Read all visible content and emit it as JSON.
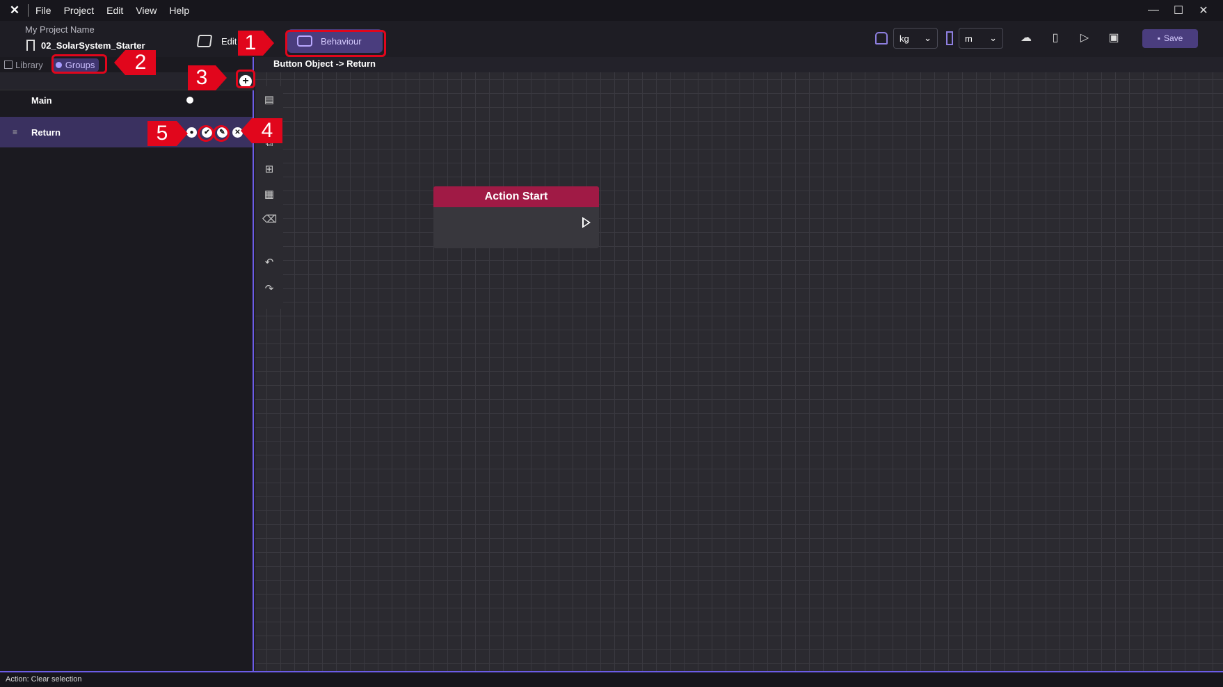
{
  "menu": {
    "items": [
      "File",
      "Project",
      "Edit",
      "View",
      "Help"
    ]
  },
  "header": {
    "project_name": "My Project Name",
    "file_name": "02_SolarSystem_Starter",
    "edit_label": "Edit",
    "behaviour_label": "Behaviour",
    "weight_unit": "kg",
    "length_unit": "m",
    "save_label": "Save"
  },
  "left_panel": {
    "tabs": {
      "library": "Library",
      "groups": "Groups"
    },
    "items": [
      {
        "label": "Main"
      },
      {
        "label": "Return"
      }
    ]
  },
  "breadcrumb": "Button Object -> Return",
  "node": {
    "title": "Action Start"
  },
  "status": "Action: Clear selection",
  "annotations": [
    "1",
    "2",
    "3",
    "4",
    "5"
  ],
  "colors": {
    "accent": "#6c5ce7",
    "annotation": "#e1061c",
    "node_header": "#a01a45"
  }
}
